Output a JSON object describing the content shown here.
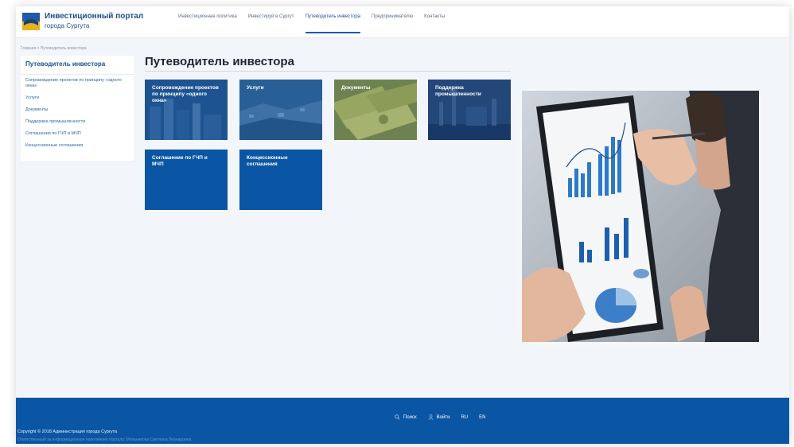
{
  "header": {
    "brand_title": "Инвестиционный портал",
    "brand_subtitle": "города Сургута",
    "nav": [
      {
        "label": "Инвестиционная политика"
      },
      {
        "label": "Инвестируй в Сургут"
      },
      {
        "label": "Путеводитель инвестора",
        "active": true
      },
      {
        "label": "Предпринимателю"
      },
      {
        "label": "Контакты"
      }
    ]
  },
  "breadcrumb": "Главная > Путеводитель инвестора",
  "sidebar": {
    "title": "Путеводитель инвестора",
    "items": [
      {
        "label": "Сопровождение проектов по принципу «одного окна»"
      },
      {
        "label": "Услуги"
      },
      {
        "label": "Документы"
      },
      {
        "label": "Поддержка промышленности"
      },
      {
        "label": "Соглашения по ГЧП и МЧП"
      },
      {
        "label": "Концессионные соглашения"
      }
    ]
  },
  "main": {
    "title": "Путеводитель инвестора",
    "tiles": [
      {
        "label": "Сопровождение проектов по принципу «одного окна»",
        "image": "city-buildings"
      },
      {
        "label": "Услуги",
        "image": "city-aerial"
      },
      {
        "label": "Документы",
        "image": "money-bills"
      },
      {
        "label": "Поддержка промышленности",
        "image": "industry"
      },
      {
        "label": "Соглашение по ГЧП и МЧП",
        "image": "none"
      },
      {
        "label": "Концессионные соглашения",
        "image": "none"
      }
    ]
  },
  "footer": {
    "search_label": "Поиск",
    "login_label": "Войти",
    "lang_ru": "RU",
    "lang_en": "EN",
    "copyright": "Copyright © 2018 Администрация города Сургута",
    "note": "Ответственный за информационное наполнение портала: Мельникова Светлана Леонидовна"
  },
  "colors": {
    "brand_blue": "#0b56a4",
    "link_blue": "#2a64ad",
    "background": "#f2f5f9"
  }
}
